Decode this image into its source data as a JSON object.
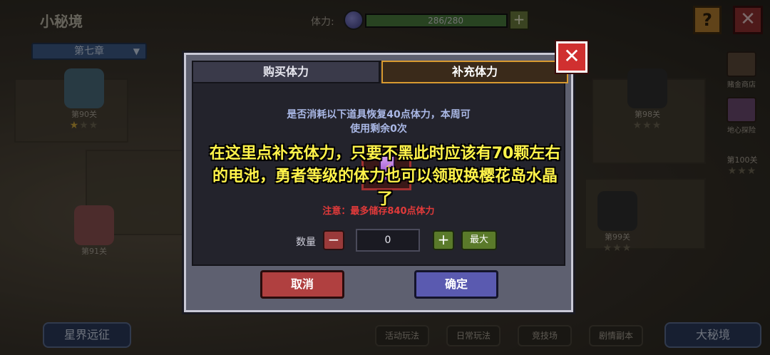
{
  "header": {
    "title": "小秘境",
    "chapter": "第七章",
    "stamina_label": "体力:",
    "stamina_value": "286/280",
    "stamina_fill": 1.0,
    "help_icon": "?",
    "close_icon": "✕"
  },
  "side_menu": [
    {
      "label": "赌金商店",
      "icon": "shop-icon"
    },
    {
      "label": "地心探险",
      "icon": "crystal-icon"
    }
  ],
  "levels": [
    {
      "label": "第90关",
      "stars": 1
    },
    {
      "label": "第91关",
      "stars": 0
    },
    {
      "label": "第98关",
      "stars": 0
    },
    {
      "label": "第99关",
      "stars": 0
    },
    {
      "label": "第100关",
      "stars": 0
    }
  ],
  "bottom": {
    "left_big": "星界远征",
    "right_big": "大秘境",
    "buttons": [
      "活动玩法",
      "日常玩法",
      "竞技场",
      "剧情副本"
    ]
  },
  "modal": {
    "tab_buy": "购买体力",
    "tab_refill": "补充体力",
    "desc_line1": "是否消耗以下道具恢复40点体力，本周可",
    "desc_line2": "使用剩余0次",
    "warning": "注意：最多储存840点体力",
    "qty_label": "数量",
    "qty_value": "0",
    "minus": "−",
    "plus": "+",
    "max": "最大",
    "cancel": "取消",
    "confirm": "确定",
    "close": "✕"
  },
  "caption": {
    "line1": "在这里点补充体力，只要不黑此时应该有70颗左右",
    "line2": "的电池，勇者等级的体力也可以领取换樱花岛水晶",
    "line3": "了"
  }
}
